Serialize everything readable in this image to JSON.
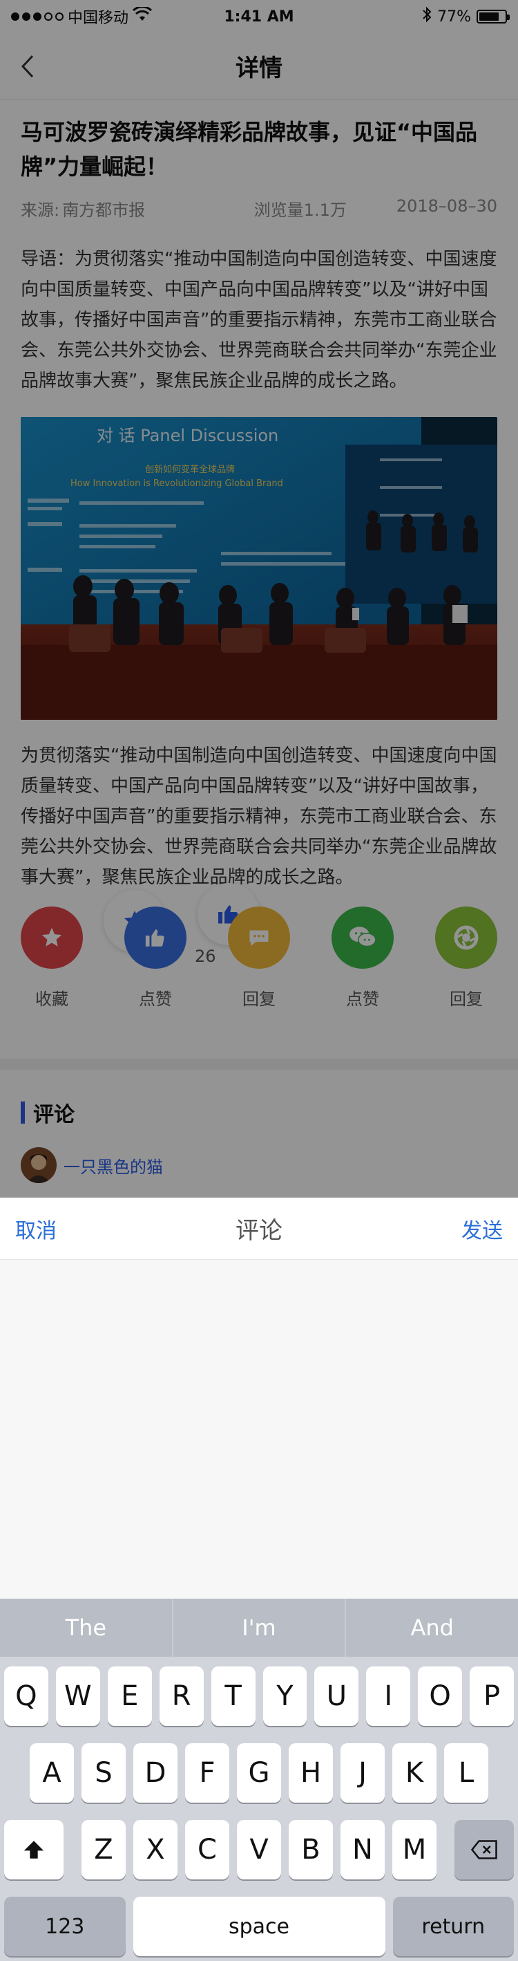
{
  "status_bar": {
    "carrier": "中国移动",
    "time": "1:41 AM",
    "battery_text": "77%",
    "battery_level": 0.77
  },
  "nav": {
    "title": "详情"
  },
  "article": {
    "title": "马可波罗瓷砖演绎精彩品牌故事，见证“中国品牌”力量崛起！",
    "source_label": "来源:",
    "source": "南方都市报",
    "views": "浏览量1.1万",
    "date": "2018–08–30",
    "lead": "导语：为贯彻落实“推动中国制造向中国创造转变、中国速度向中国质量转变、中国产品向中国品牌转变”以及“讲好中国故事，传播好中国声音”的重要指示精神，东莞市工商业联合会、东莞公共外交协会、世界莞商联合会共同举办“东莞企业品牌故事大赛”，聚焦民族企业品牌的成长之路。",
    "image": {
      "heading": "对 话  Panel Discussion",
      "subheading": "创新如何变革全球品牌",
      "subheading_en": "How Innovation is Revolutionizing Global Brand"
    },
    "body": "为贯彻落实“推动中国制造向中国创造转变、中国速度向中国质量转变、中国产品向中国品牌转变”以及“讲好中国故事，传播好中国声音”的重要指示精神，东莞市工商业联合会、东莞公共外交协会、世界莞商联合会共同举办“东莞企业品牌故事大赛”，聚焦民族企业品牌的成长之路。"
  },
  "actions": {
    "items": [
      {
        "label": "收藏",
        "color": "#e0464a",
        "icon": "star-icon"
      },
      {
        "label": "点赞",
        "color": "#3a6fe0",
        "icon": "thumbs-up-icon"
      },
      {
        "label": "回复",
        "color": "#f0b93a",
        "icon": "chat-bubble-icon"
      },
      {
        "label": "点赞",
        "color": "#3cb84a",
        "icon": "wechat-icon"
      },
      {
        "label": "回复",
        "color": "#8ac43a",
        "icon": "moments-icon"
      }
    ],
    "like_count": "26"
  },
  "comments": {
    "title": "评论",
    "first_user": "一只黑色的猫"
  },
  "compose": {
    "cancel": "取消",
    "title": "评论",
    "send": "发送"
  },
  "keyboard": {
    "suggestions": [
      "The",
      "I'm",
      "And"
    ],
    "row1": [
      "Q",
      "W",
      "E",
      "R",
      "T",
      "Y",
      "U",
      "I",
      "O",
      "P"
    ],
    "row2": [
      "A",
      "S",
      "D",
      "F",
      "G",
      "H",
      "J",
      "K",
      "L"
    ],
    "row3": [
      "Z",
      "X",
      "C",
      "V",
      "B",
      "N",
      "M"
    ],
    "num_label": "123",
    "space_label": "space",
    "return_label": "return"
  }
}
